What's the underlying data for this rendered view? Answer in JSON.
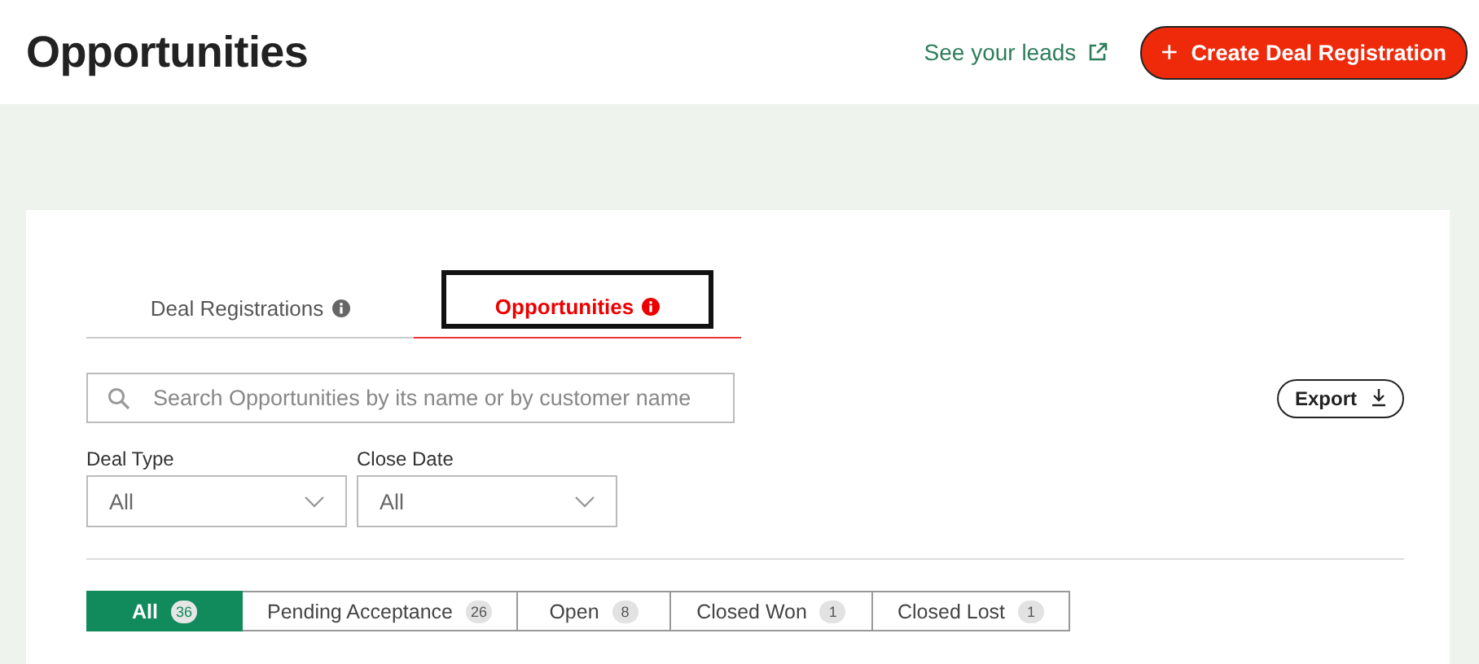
{
  "page_title": "Opportunities",
  "leads_link": {
    "label": "See your leads"
  },
  "create_button": {
    "icon": "+",
    "label": "Create Deal Registration"
  },
  "tabs": [
    {
      "label": "Deal Registrations",
      "selected": false,
      "focused": false
    },
    {
      "label": "Opportunities",
      "selected": true,
      "focused": true
    }
  ],
  "search": {
    "placeholder": "Search Opportunities by its name or by customer name"
  },
  "export_button": {
    "label": "Export"
  },
  "filters": [
    {
      "label": "Deal Type",
      "value": "All"
    },
    {
      "label": "Close Date",
      "value": "All"
    }
  ],
  "status_tabs": [
    {
      "label": "All",
      "count": "36",
      "selected": true
    },
    {
      "label": "Pending Acceptance",
      "count": "26",
      "selected": false
    },
    {
      "label": "Open",
      "count": "8",
      "selected": false
    },
    {
      "label": "Closed Won",
      "count": "1",
      "selected": false
    },
    {
      "label": "Closed Lost",
      "count": "1",
      "selected": false
    }
  ]
}
